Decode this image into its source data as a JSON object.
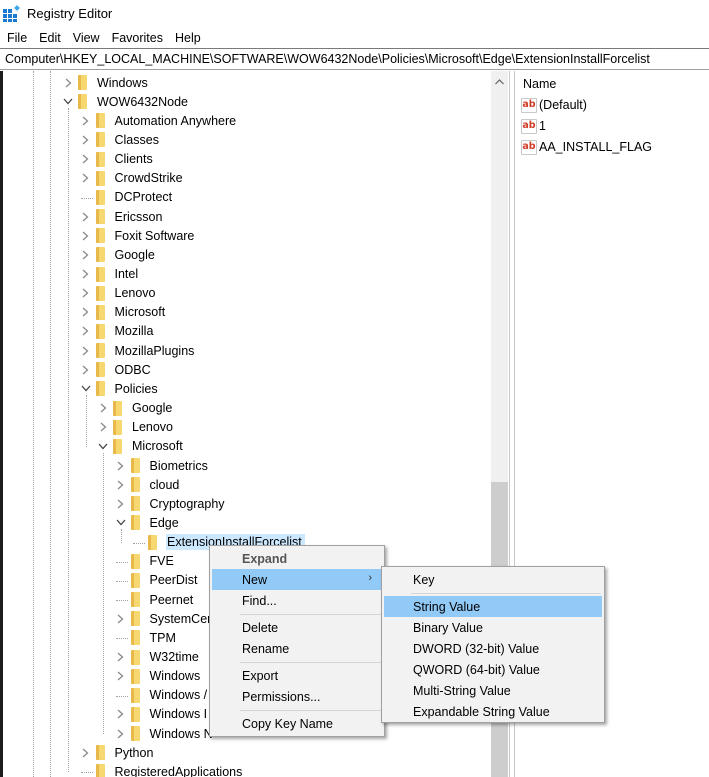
{
  "window": {
    "title": "Registry Editor",
    "icon": "regedit-icon"
  },
  "menubar": {
    "items": [
      {
        "label": "File"
      },
      {
        "label": "Edit"
      },
      {
        "label": "View"
      },
      {
        "label": "Favorites"
      },
      {
        "label": "Help"
      }
    ]
  },
  "address": {
    "path": "Computer\\HKEY_LOCAL_MACHINE\\SOFTWARE\\WOW6432Node\\Policies\\Microsoft\\Edge\\ExtensionInstallForcelist"
  },
  "tree": {
    "nodes": [
      {
        "label": "Windows",
        "depth": 0,
        "state": "collapsed"
      },
      {
        "label": "WOW6432Node",
        "depth": 0,
        "state": "expanded"
      },
      {
        "label": "Automation Anywhere",
        "depth": 1,
        "state": "collapsed"
      },
      {
        "label": "Classes",
        "depth": 1,
        "state": "collapsed"
      },
      {
        "label": "Clients",
        "depth": 1,
        "state": "collapsed"
      },
      {
        "label": "CrowdStrike",
        "depth": 1,
        "state": "collapsed"
      },
      {
        "label": "DCProtect",
        "depth": 1,
        "state": "leaf"
      },
      {
        "label": "Ericsson",
        "depth": 1,
        "state": "collapsed"
      },
      {
        "label": "Foxit Software",
        "depth": 1,
        "state": "collapsed"
      },
      {
        "label": "Google",
        "depth": 1,
        "state": "collapsed"
      },
      {
        "label": "Intel",
        "depth": 1,
        "state": "collapsed"
      },
      {
        "label": "Lenovo",
        "depth": 1,
        "state": "collapsed"
      },
      {
        "label": "Microsoft",
        "depth": 1,
        "state": "collapsed"
      },
      {
        "label": "Mozilla",
        "depth": 1,
        "state": "collapsed"
      },
      {
        "label": "MozillaPlugins",
        "depth": 1,
        "state": "collapsed"
      },
      {
        "label": "ODBC",
        "depth": 1,
        "state": "collapsed"
      },
      {
        "label": "Policies",
        "depth": 1,
        "state": "expanded"
      },
      {
        "label": "Google",
        "depth": 2,
        "state": "collapsed"
      },
      {
        "label": "Lenovo",
        "depth": 2,
        "state": "collapsed"
      },
      {
        "label": "Microsoft",
        "depth": 2,
        "state": "expanded"
      },
      {
        "label": "Biometrics",
        "depth": 3,
        "state": "collapsed"
      },
      {
        "label": "cloud",
        "depth": 3,
        "state": "collapsed"
      },
      {
        "label": "Cryptography",
        "depth": 3,
        "state": "collapsed"
      },
      {
        "label": "Edge",
        "depth": 3,
        "state": "expanded"
      },
      {
        "label": "ExtensionInstallForcelist",
        "depth": 4,
        "state": "leaf",
        "selected": true
      },
      {
        "label": "FVE",
        "depth": 3,
        "state": "leaf"
      },
      {
        "label": "PeerDist",
        "depth": 3,
        "state": "leaf"
      },
      {
        "label": "Peernet",
        "depth": 3,
        "state": "leaf"
      },
      {
        "label": "SystemCer",
        "depth": 3,
        "state": "collapsed"
      },
      {
        "label": "TPM",
        "depth": 3,
        "state": "leaf"
      },
      {
        "label": "W32time",
        "depth": 3,
        "state": "collapsed"
      },
      {
        "label": "Windows",
        "depth": 3,
        "state": "collapsed"
      },
      {
        "label": "Windows /",
        "depth": 3,
        "state": "leaf"
      },
      {
        "label": "Windows I",
        "depth": 3,
        "state": "collapsed"
      },
      {
        "label": "Windows N",
        "depth": 3,
        "state": "collapsed"
      },
      {
        "label": "Python",
        "depth": 1,
        "state": "collapsed"
      },
      {
        "label": "RegisteredApplications",
        "depth": 1,
        "state": "leaf"
      }
    ]
  },
  "values_pane": {
    "column_header": "Name",
    "values": [
      {
        "name": "(Default)",
        "icon": "string-value-icon"
      },
      {
        "name": "1",
        "icon": "string-value-icon"
      },
      {
        "name": "AA_INSTALL_FLAG",
        "icon": "string-value-icon"
      }
    ]
  },
  "context_menu": {
    "items": [
      {
        "label": "Expand",
        "bold": true
      },
      {
        "label": "New",
        "has_submenu": true,
        "highlighted": true
      },
      {
        "label": "Find..."
      },
      {
        "separator": true
      },
      {
        "label": "Delete"
      },
      {
        "label": "Rename"
      },
      {
        "separator": true
      },
      {
        "label": "Export"
      },
      {
        "label": "Permissions..."
      },
      {
        "separator": true
      },
      {
        "label": "Copy Key Name"
      }
    ],
    "submenu_arrow": "›"
  },
  "new_submenu": {
    "items": [
      {
        "label": "Key"
      },
      {
        "separator": true
      },
      {
        "label": "String Value",
        "highlighted": true
      },
      {
        "label": "Binary Value"
      },
      {
        "label": "DWORD (32-bit) Value"
      },
      {
        "label": "QWORD (64-bit) Value"
      },
      {
        "label": "Multi-String Value"
      },
      {
        "label": "Expandable String Value"
      }
    ]
  },
  "scrollbar": {
    "up_arrow": "^",
    "position_fraction": 0.58
  },
  "colors": {
    "selection": "#cce8ff",
    "menu_highlight": "#91c9f7",
    "folder": "#f7d770",
    "string_icon": "#d23b26"
  }
}
